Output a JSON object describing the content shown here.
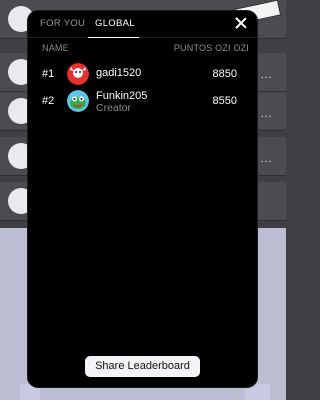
{
  "tabs": [
    {
      "label": "FOR YOU",
      "active": false
    },
    {
      "label": "GLOBAL",
      "active": true
    }
  ],
  "columns": {
    "name": "NAME",
    "points": "PUNTOS OZI OZI"
  },
  "leaderboard": [
    {
      "rank": "#1",
      "username": "gadi1520",
      "subtitle": "",
      "score": "8850",
      "avatar_color": "#e8302f"
    },
    {
      "rank": "#2",
      "username": "Funkin205",
      "subtitle": "Creator",
      "score": "8550",
      "avatar_color": "#3aa94a"
    }
  ],
  "share_button": "Share Leaderboard",
  "colors": {
    "modal_bg": "#000000",
    "muted_text": "#8d8d93",
    "button_bg": "#f4f4f8"
  }
}
